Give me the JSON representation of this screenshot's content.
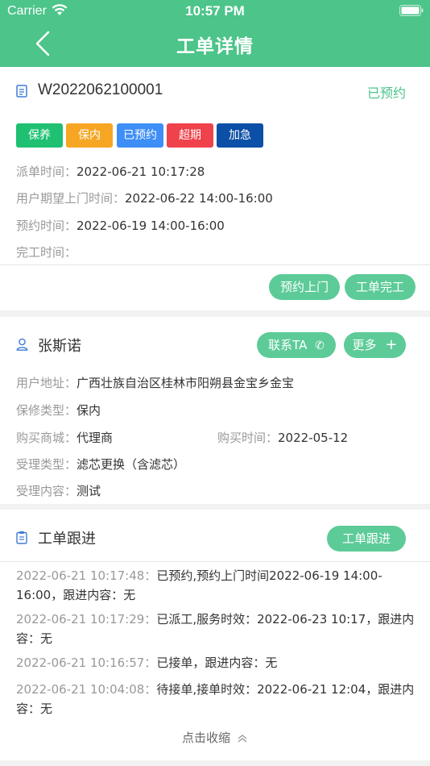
{
  "status_bar": {
    "carrier": "Carrier",
    "time": "10:57 PM"
  },
  "nav": {
    "title": "工单详情"
  },
  "order": {
    "number": "W2022062100001",
    "status": "已预约",
    "tags": [
      {
        "label": "保养",
        "color": "#1fc072"
      },
      {
        "label": "保内",
        "color": "#f6a623"
      },
      {
        "label": "已预约",
        "color": "#3e8ef7"
      },
      {
        "label": "超期",
        "color": "#f0424b"
      },
      {
        "label": "加急",
        "color": "#0b4fa6"
      }
    ],
    "rows": [
      {
        "label": "派单时间：",
        "value": "2022-06-21 10:17:28"
      },
      {
        "label": "用户期望上门时间：",
        "value": "2022-06-22 14:00-16:00"
      },
      {
        "label": "预约时间：",
        "value": "2022-06-19 14:00-16:00"
      },
      {
        "label": "完工时间：",
        "value": ""
      }
    ],
    "actions": {
      "appointment": "预约上门",
      "complete": "工单完工"
    }
  },
  "customer": {
    "name": "张斯诺",
    "contact_label": "联系TA",
    "more_label": "更多",
    "address_label": "用户地址：",
    "address": "广西壮族自治区桂林市阳朔县金宝乡金宝",
    "warranty_label": "保修类型：",
    "warranty": "保内",
    "mall_label": "购买商城：",
    "mall": "代理商",
    "purchase_time_label": "购买时间：",
    "purchase_time": "2022-05-12",
    "handle_type_label": "受理类型：",
    "handle_type": "滤芯更换（含滤芯）",
    "handle_content_label": "受理内容：",
    "handle_content": "测试"
  },
  "follow": {
    "title": "工单跟进",
    "button": "工单跟进",
    "entries": [
      {
        "time": "2022-06-21 10:17:48：",
        "text": "已预约,预约上门时间2022-06-19 14:00-16:00，跟进内容：无"
      },
      {
        "time": "2022-06-21 10:17:29：",
        "text": "已派工,服务时效：2022-06-23 10:17，跟进内容：无"
      },
      {
        "time": "2022-06-21 10:16:57：",
        "text": "已接单，跟进内容：无"
      },
      {
        "time": "2022-06-21 10:04:08：",
        "text": "待接单,接单时效：2022-06-21 12:04，跟进内容：无"
      }
    ],
    "collapse": "点击收缩"
  }
}
